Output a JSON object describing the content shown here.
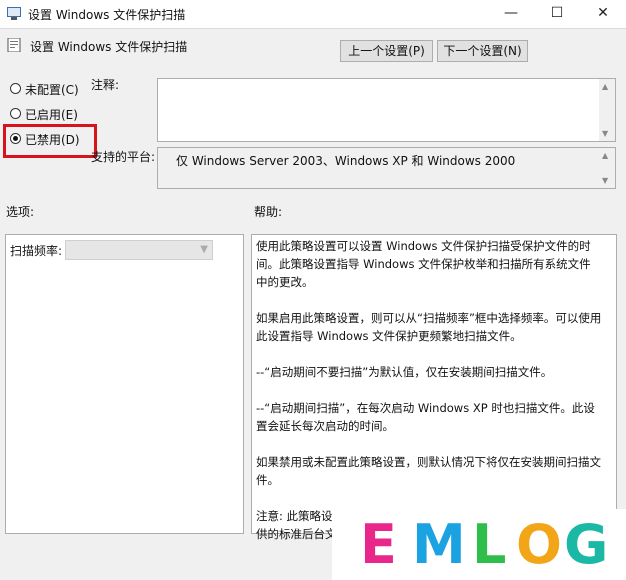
{
  "window": {
    "title": "设置 Windows 文件保护扫描",
    "controls": [
      "—",
      "☐",
      "✕"
    ]
  },
  "header": {
    "title": "设置 Windows 文件保护扫描",
    "prev_button": "上一个设置(P)",
    "next_button": "下一个设置(N)"
  },
  "state": {
    "options": [
      "未配置(C)",
      "已启用(E)",
      "已禁用(D)"
    ],
    "selected": "已禁用(D)"
  },
  "comment": {
    "label": "注释:",
    "value": ""
  },
  "platform": {
    "label": "支持的平台:",
    "value": "仅 Windows Server 2003、Windows XP 和 Windows 2000"
  },
  "options_section": {
    "label": "选项:",
    "scan_frequency_label": "扫描频率:",
    "scan_frequency_value": ""
  },
  "help": {
    "label": "帮助:",
    "paragraphs": [
      "使用此策略设置可以设置 Windows 文件保护扫描受保护文件的时间。此策略设置指导 Windows 文件保护枚举和扫描所有系统文件中的更改。",
      "如果启用此策略设置，则可以从“扫描频率”框中选择频率。可以使用此设置指导 Windows 文件保护更频繁地扫描文件。",
      "--“启动期间不要扫描”为默认值，仅在安装期间扫描文件。",
      "--“启动期间扫描”，在每次启动 Windows XP 时也扫描文件。此设置会延长每次启动的时间。",
      "如果禁用或未配置此策略设置，则默认情况下将仅在安装期间扫描文件。",
      "注意: 此策略设置仅影响文件扫描，而不影响 Windows 文件保护提供的标准后台文件更改检测。"
    ]
  },
  "watermark": {
    "text": "EMLOG",
    "colors": [
      "#e9268a",
      "#1aa3e0",
      "#2fbe4a",
      "#f2a516",
      "#1bb9a5"
    ]
  }
}
